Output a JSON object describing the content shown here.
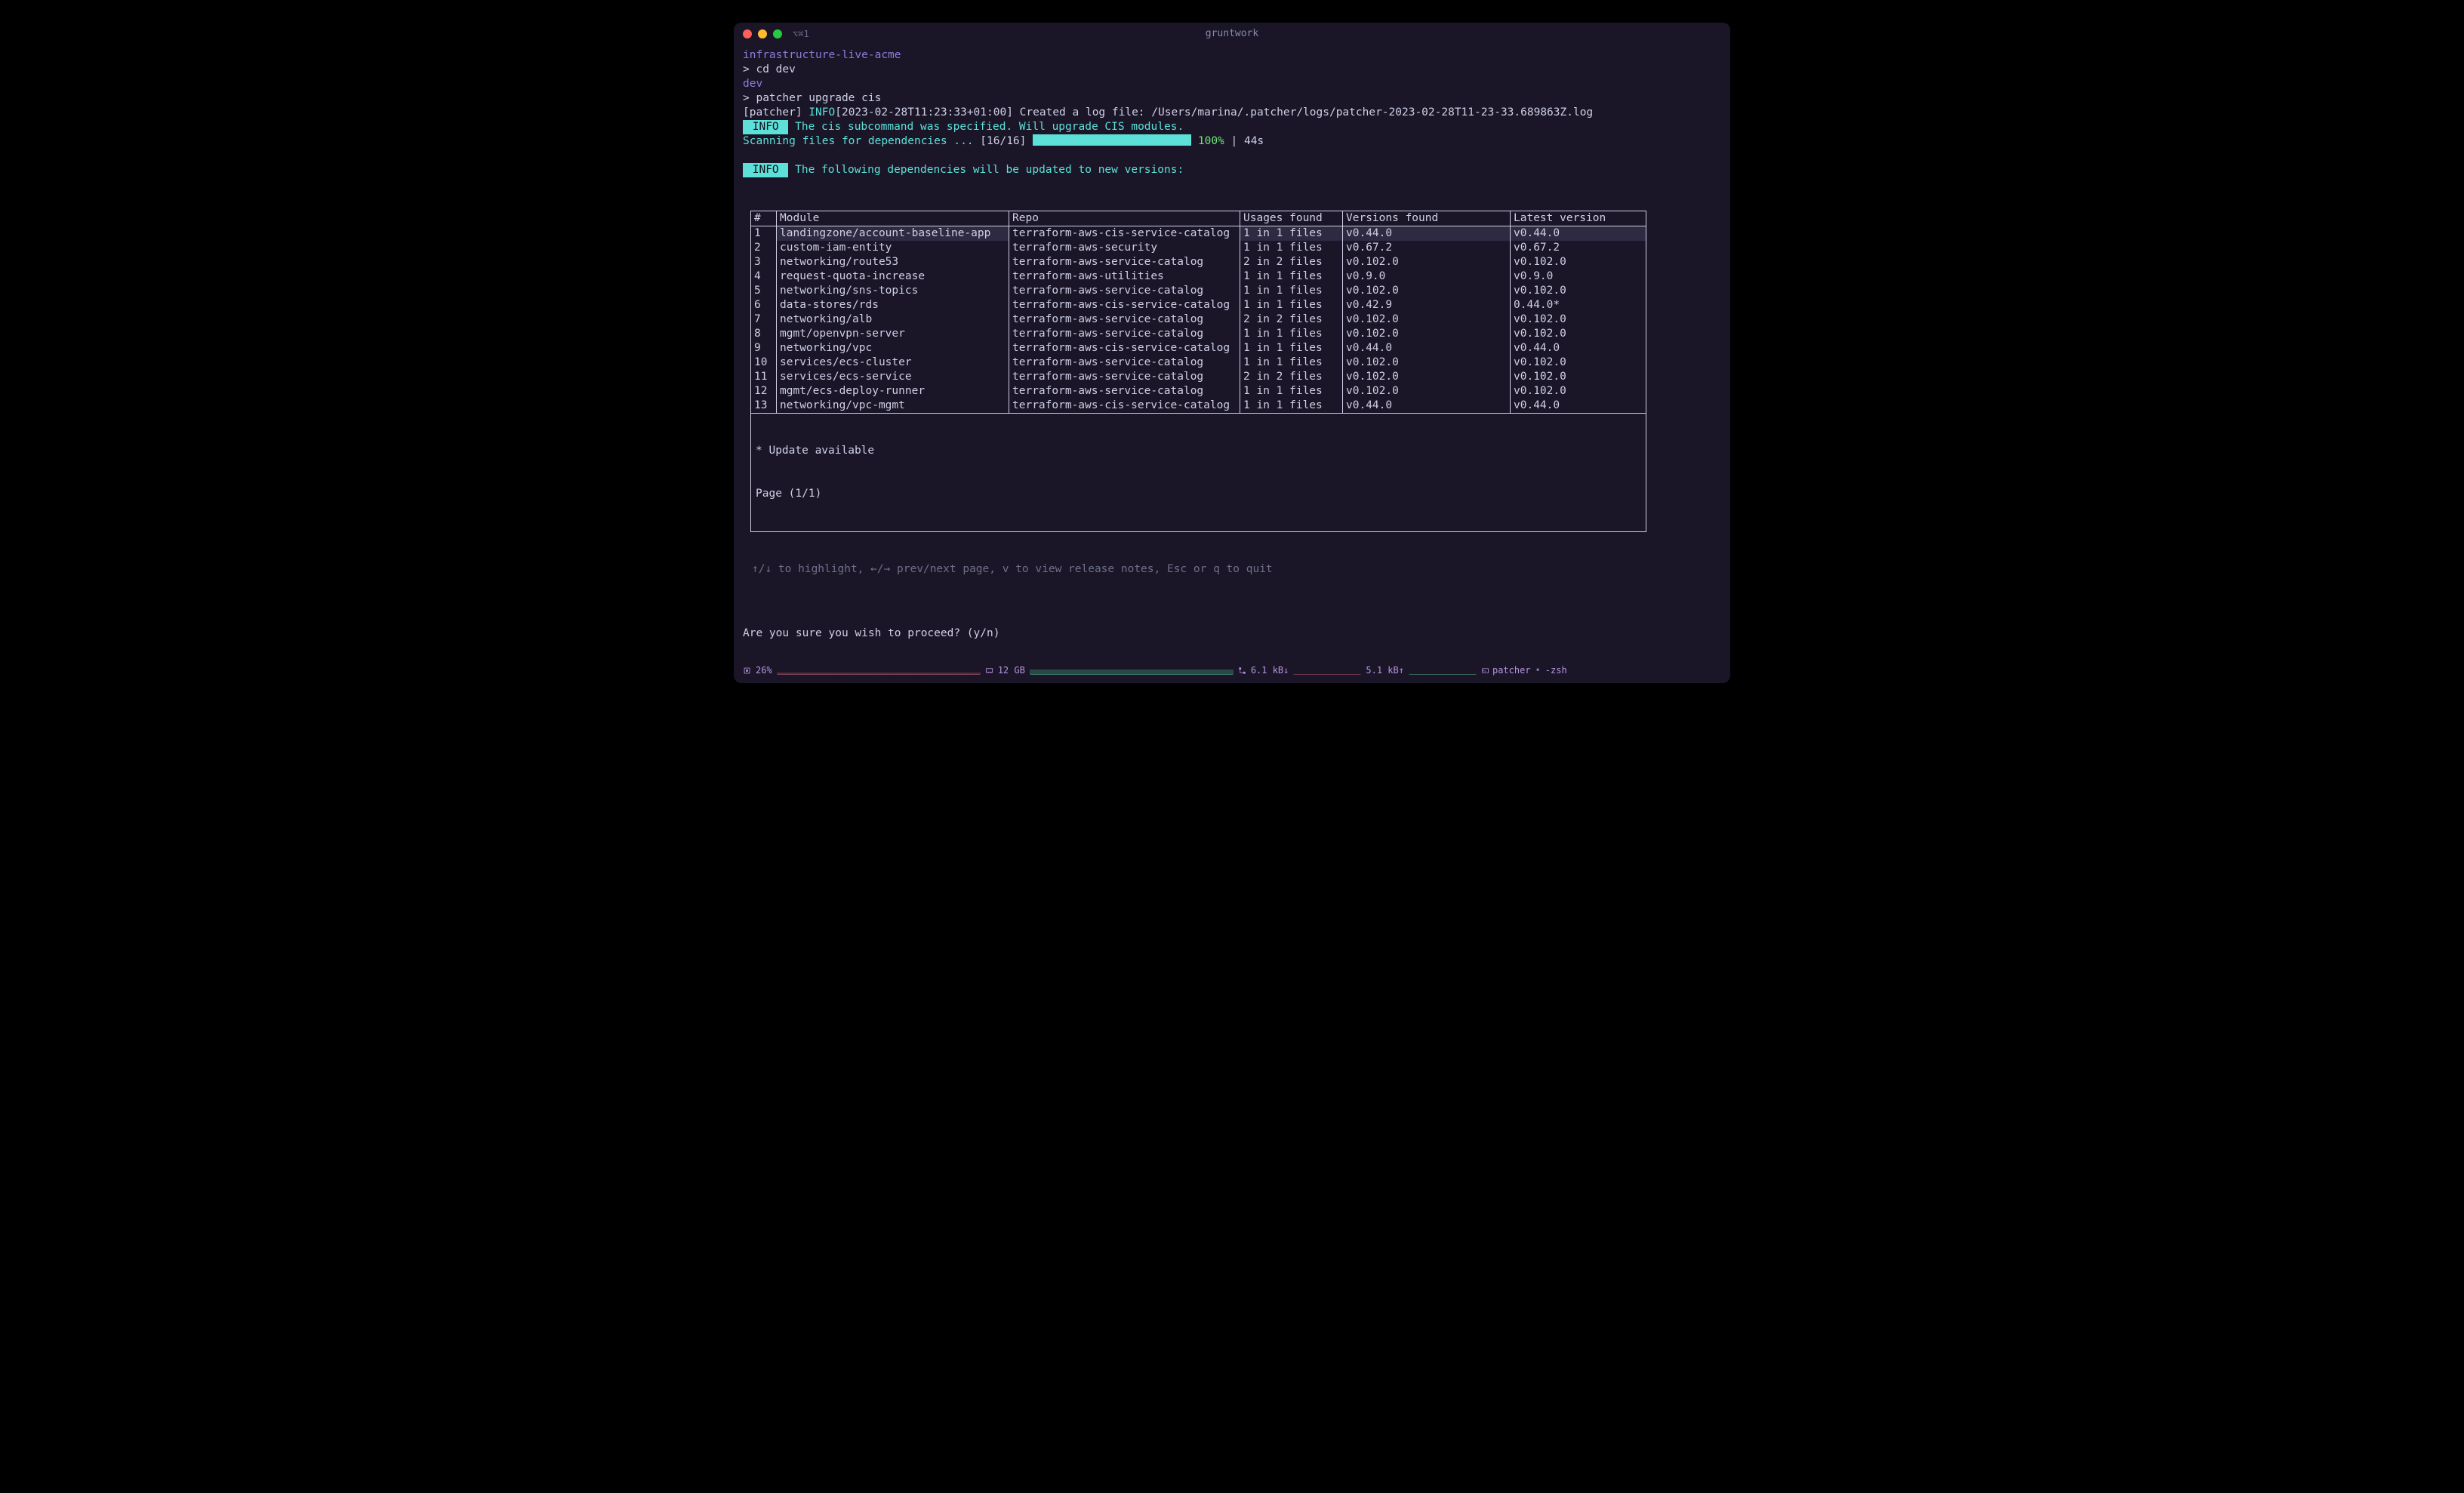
{
  "window": {
    "title": "gruntwork",
    "tab_hint": "⌥⌘1"
  },
  "terminal": {
    "cwd1": "infrastructure-live-acme",
    "cmd1_prefix": "> ",
    "cmd1": "cd dev",
    "cwd2": "dev",
    "cmd2_prefix": "> ",
    "cmd2": "patcher upgrade cis",
    "log_line_prefix": "[patcher] ",
    "log_level": "INFO",
    "log_timestamp": "[2023-02-28T11:23:33+01:00]",
    "log_msg": " Created a log file: /Users/marina/.patcher/logs/patcher-2023-02-28T11-23-33.689863Z.log",
    "info_badge": " INFO ",
    "info1": " The cis subcommand was specified. Will upgrade CIS modules.",
    "scan_prefix": "Scanning files for dependencies ... ",
    "scan_count": "[16/16] ",
    "scan_pct": "100%",
    "scan_time": " | 44s",
    "info2": " The following dependencies will be updated to new versions:"
  },
  "table": {
    "headers": {
      "idx": "#",
      "module": "Module",
      "repo": "Repo",
      "usages": "Usages found",
      "versions": "Versions found",
      "latest": "Latest version"
    },
    "rows": [
      {
        "n": "1",
        "module": "landingzone/account-baseline-app",
        "repo": "terraform-aws-cis-service-catalog",
        "usages": "1 in 1 files",
        "versions": "v0.44.0",
        "latest": "v0.44.0",
        "selected": true
      },
      {
        "n": "2",
        "module": "custom-iam-entity",
        "repo": "terraform-aws-security",
        "usages": "1 in 1 files",
        "versions": "v0.67.2",
        "latest": "v0.67.2"
      },
      {
        "n": "3",
        "module": "networking/route53",
        "repo": "terraform-aws-service-catalog",
        "usages": "2 in 2 files",
        "versions": "v0.102.0",
        "latest": "v0.102.0"
      },
      {
        "n": "4",
        "module": "request-quota-increase",
        "repo": "terraform-aws-utilities",
        "usages": "1 in 1 files",
        "versions": "v0.9.0",
        "latest": "v0.9.0"
      },
      {
        "n": "5",
        "module": "networking/sns-topics",
        "repo": "terraform-aws-service-catalog",
        "usages": "1 in 1 files",
        "versions": "v0.102.0",
        "latest": "v0.102.0"
      },
      {
        "n": "6",
        "module": "data-stores/rds",
        "repo": "terraform-aws-cis-service-catalog",
        "usages": "1 in 1 files",
        "versions": "v0.42.9",
        "latest": "0.44.0*"
      },
      {
        "n": "7",
        "module": "networking/alb",
        "repo": "terraform-aws-service-catalog",
        "usages": "2 in 2 files",
        "versions": "v0.102.0",
        "latest": "v0.102.0"
      },
      {
        "n": "8",
        "module": "mgmt/openvpn-server",
        "repo": "terraform-aws-service-catalog",
        "usages": "1 in 1 files",
        "versions": "v0.102.0",
        "latest": "v0.102.0"
      },
      {
        "n": "9",
        "module": "networking/vpc",
        "repo": "terraform-aws-cis-service-catalog",
        "usages": "1 in 1 files",
        "versions": "v0.44.0",
        "latest": "v0.44.0"
      },
      {
        "n": "10",
        "module": "services/ecs-cluster",
        "repo": "terraform-aws-service-catalog",
        "usages": "1 in 1 files",
        "versions": "v0.102.0",
        "latest": "v0.102.0"
      },
      {
        "n": "11",
        "module": "services/ecs-service",
        "repo": "terraform-aws-service-catalog",
        "usages": "2 in 2 files",
        "versions": "v0.102.0",
        "latest": "v0.102.0"
      },
      {
        "n": "12",
        "module": "mgmt/ecs-deploy-runner",
        "repo": "terraform-aws-service-catalog",
        "usages": "1 in 1 files",
        "versions": "v0.102.0",
        "latest": "v0.102.0"
      },
      {
        "n": "13",
        "module": "networking/vpc-mgmt",
        "repo": "terraform-aws-cis-service-catalog",
        "usages": "1 in 1 files",
        "versions": "v0.44.0",
        "latest": "v0.44.0"
      }
    ],
    "footer_note": "* Update available",
    "page": "Page (1/1)"
  },
  "hints": "↑/↓ to highlight, ←/→ prev/next page, v to view release notes, Esc or q to quit",
  "confirm": "Are you sure you wish to proceed? (y/n)",
  "status": {
    "cpu": "26%",
    "mem": "12 GB",
    "net_down": "6.1 kB↓",
    "net_up": "5.1 kB↑",
    "proc": "patcher",
    "shell": "-zsh"
  }
}
